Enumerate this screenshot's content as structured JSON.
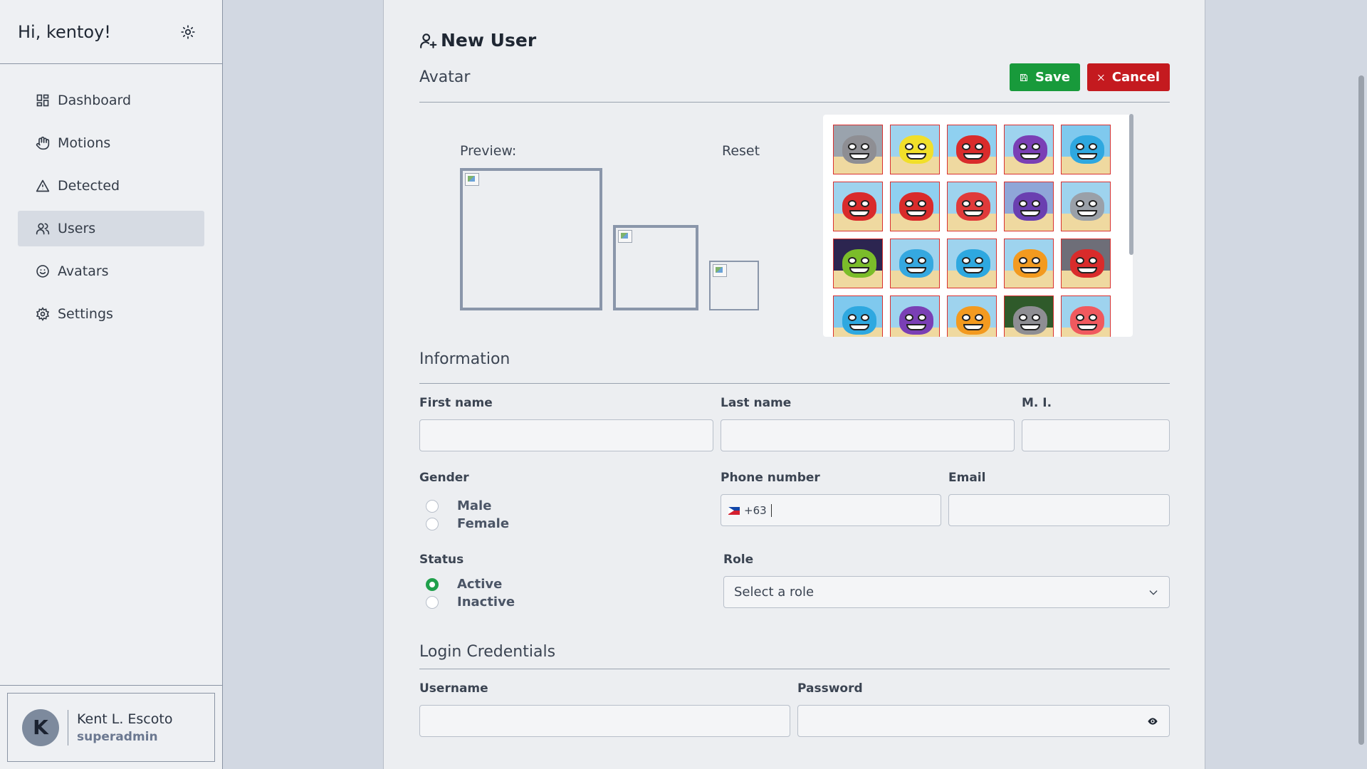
{
  "sidebar": {
    "greeting": "Hi, kentoy!",
    "theme_icon": "sun-icon",
    "items": [
      {
        "label": "Dashboard",
        "icon": "dashboard-icon"
      },
      {
        "label": "Motions",
        "icon": "hand-icon"
      },
      {
        "label": "Detected",
        "icon": "warning-icon"
      },
      {
        "label": "Users",
        "icon": "users-icon",
        "active": true
      },
      {
        "label": "Avatars",
        "icon": "smile-icon"
      },
      {
        "label": "Settings",
        "icon": "gear-icon"
      }
    ],
    "user": {
      "initial": "K",
      "name": "Kent L. Escoto",
      "role": "superadmin"
    }
  },
  "form": {
    "title": "New User",
    "save_label": "Save",
    "cancel_label": "Cancel",
    "avatar_section": "Avatar",
    "preview_label": "Preview:",
    "reset_label": "Reset",
    "info_section": "Information",
    "first_name_label": "First name",
    "first_name_value": "",
    "last_name_label": "Last name",
    "last_name_value": "",
    "mi_label": "M. I.",
    "mi_value": "",
    "gender_label": "Gender",
    "gender_options": [
      "Male",
      "Female"
    ],
    "phone_label": "Phone number",
    "phone_prefix": "+63",
    "email_label": "Email",
    "email_value": "",
    "status_label": "Status",
    "status_options": [
      "Active",
      "Inactive"
    ],
    "status_selected": "Active",
    "role_label": "Role",
    "role_placeholder": "Select a role",
    "login_section": "Login Credentials",
    "username_label": "Username",
    "password_label": "Password"
  },
  "colors": {
    "save": "#189a3b",
    "cancel": "#c41a1f",
    "active_radio": "#1fa04b",
    "avatar_border": "#d93030"
  },
  "avatars": [
    {
      "color": "#8e8e93",
      "bg": "#9aa3ad"
    },
    {
      "color": "#f1df2a",
      "bg": "#9ed3ee"
    },
    {
      "color": "#d92b2b",
      "bg": "#8fd0f0"
    },
    {
      "color": "#7a3fb5",
      "bg": "#9ed3ee"
    },
    {
      "color": "#2ea8e0",
      "bg": "#7fc9ee"
    },
    {
      "color": "#d92b2b",
      "bg": "#9ed3ee"
    },
    {
      "color": "#d92b2b",
      "bg": "#8fd0f0"
    },
    {
      "color": "#e03a3a",
      "bg": "#9ed3ee"
    },
    {
      "color": "#6a3fb0",
      "bg": "#8fa6d8"
    },
    {
      "color": "#9aa0a8",
      "bg": "#9ed3ee"
    },
    {
      "color": "#7bbd2a",
      "bg": "#2c2550"
    },
    {
      "color": "#35a8e0",
      "bg": "#9ed3ee"
    },
    {
      "color": "#2ea8e0",
      "bg": "#9ed3ee"
    },
    {
      "color": "#f39a1f",
      "bg": "#9ed3ee"
    },
    {
      "color": "#d92b2b",
      "bg": "#6e6e78"
    },
    {
      "color": "#2ea8e0",
      "bg": "#7fc9ee"
    },
    {
      "color": "#7a3fb5",
      "bg": "#9ed3ee"
    },
    {
      "color": "#f39a1f",
      "bg": "#9ed3ee"
    },
    {
      "color": "#8e8e93",
      "bg": "#2f5a2a"
    },
    {
      "color": "#f0595e",
      "bg": "#9ed3ee"
    }
  ]
}
